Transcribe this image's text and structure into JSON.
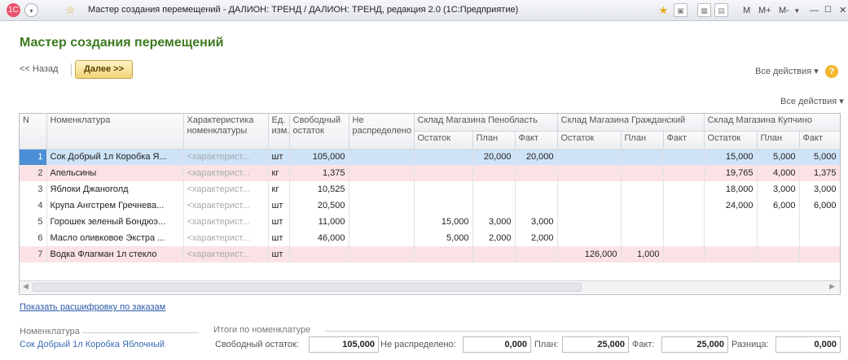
{
  "window": {
    "title": "Мастер создания перемещений - ДАЛИОН: ТРЕНД / ДАЛИОН: ТРЕНД, редакция 2.0  (1С:Предприятие)",
    "buttons": [
      "M",
      "M+",
      "M-"
    ]
  },
  "page": {
    "title": "Мастер создания перемещений"
  },
  "toolbar": {
    "back_label": "<< Назад",
    "next_label": "Далее >>",
    "all_actions": "Все действия ▾",
    "help": "?"
  },
  "table": {
    "all_actions": "Все действия ▾",
    "columns": {
      "n": "N",
      "nomenclature": "Номенклатура",
      "characteristic": "Характеристика номенклатуры",
      "unit": "Ед. изм.",
      "free": "Свободный остаток",
      "undistributed": "Не распределено",
      "wh1": "Склад Магазина Пенобласть",
      "wh2": "Склад Магазина Гражданский",
      "wh3": "Склад Магазина Купчино",
      "sub_rest": "Остаток",
      "sub_plan": "План",
      "sub_fact": "Факт"
    },
    "rows": [
      {
        "n": "1",
        "name": "Сок Добрый 1л Коробка Я...",
        "char": "<характерист...",
        "unit": "шт",
        "free": "105,000",
        "und": "",
        "w1r": "",
        "w1p": "20,000",
        "w1f": "20,000",
        "w2r": "",
        "w2p": "",
        "w2f": "",
        "w3r": "15,000",
        "w3p": "5,000",
        "w3f": "5,000"
      },
      {
        "n": "2",
        "name": "Апельсины",
        "char": "<характерист...",
        "unit": "кг",
        "free": "1,375",
        "und": "",
        "w1r": "",
        "w1p": "",
        "w1f": "",
        "w2r": "",
        "w2p": "",
        "w2f": "",
        "w3r": "19,765",
        "w3p": "4,000",
        "w3f": "1,375"
      },
      {
        "n": "3",
        "name": "Яблоки Джаноголд",
        "char": "<характерист...",
        "unit": "кг",
        "free": "10,525",
        "und": "",
        "w1r": "",
        "w1p": "",
        "w1f": "",
        "w2r": "",
        "w2p": "",
        "w2f": "",
        "w3r": "18,000",
        "w3p": "3,000",
        "w3f": "3,000"
      },
      {
        "n": "4",
        "name": "Крупа Ангстрем Гречнева...",
        "char": "<характерист...",
        "unit": "шт",
        "free": "20,500",
        "und": "",
        "w1r": "",
        "w1p": "",
        "w1f": "",
        "w2r": "",
        "w2p": "",
        "w2f": "",
        "w3r": "24,000",
        "w3p": "6,000",
        "w3f": "6,000"
      },
      {
        "n": "5",
        "name": "Горошек зеленый Бондюэ...",
        "char": "<характерист...",
        "unit": "шт",
        "free": "11,000",
        "und": "",
        "w1r": "15,000",
        "w1p": "3,000",
        "w1f": "3,000",
        "w2r": "",
        "w2p": "",
        "w2f": "",
        "w3r": "",
        "w3p": "",
        "w3f": ""
      },
      {
        "n": "6",
        "name": "Масло оливковое Экстра ...",
        "char": "<характерист...",
        "unit": "шт",
        "free": "46,000",
        "und": "",
        "w1r": "5,000",
        "w1p": "2,000",
        "w1f": "2,000",
        "w2r": "",
        "w2p": "",
        "w2f": "",
        "w3r": "",
        "w3p": "",
        "w3f": ""
      },
      {
        "n": "7",
        "name": "Водка Флагман 1л стекло",
        "char": "<характерист...",
        "unit": "шт",
        "free": "",
        "und": "",
        "w1r": "",
        "w1p": "",
        "w1f": "",
        "w2r": "126,000",
        "w2p": "1,000",
        "w2f": "",
        "w3r": "",
        "w3p": "",
        "w3f": ""
      }
    ],
    "row_styles": [
      "sel",
      "pink",
      "",
      "",
      "",
      "",
      "pink"
    ]
  },
  "footer": {
    "link": "Показать расшифровку по заказам",
    "nom_group": "Номенклатура",
    "nom_value": "Сок Добрый 1л Коробка Яблочный",
    "totals_group": "Итоги по номенклатуре",
    "free_label": "Свободный остаток:",
    "free_value": "105,000",
    "und_label": "Не распределено:",
    "und_value": "0,000",
    "plan_label": "План:",
    "plan_value": "25,000",
    "fact_label": "Факт:",
    "fact_value": "25,000",
    "diff_label": "Разница:",
    "diff_value": "0,000"
  }
}
